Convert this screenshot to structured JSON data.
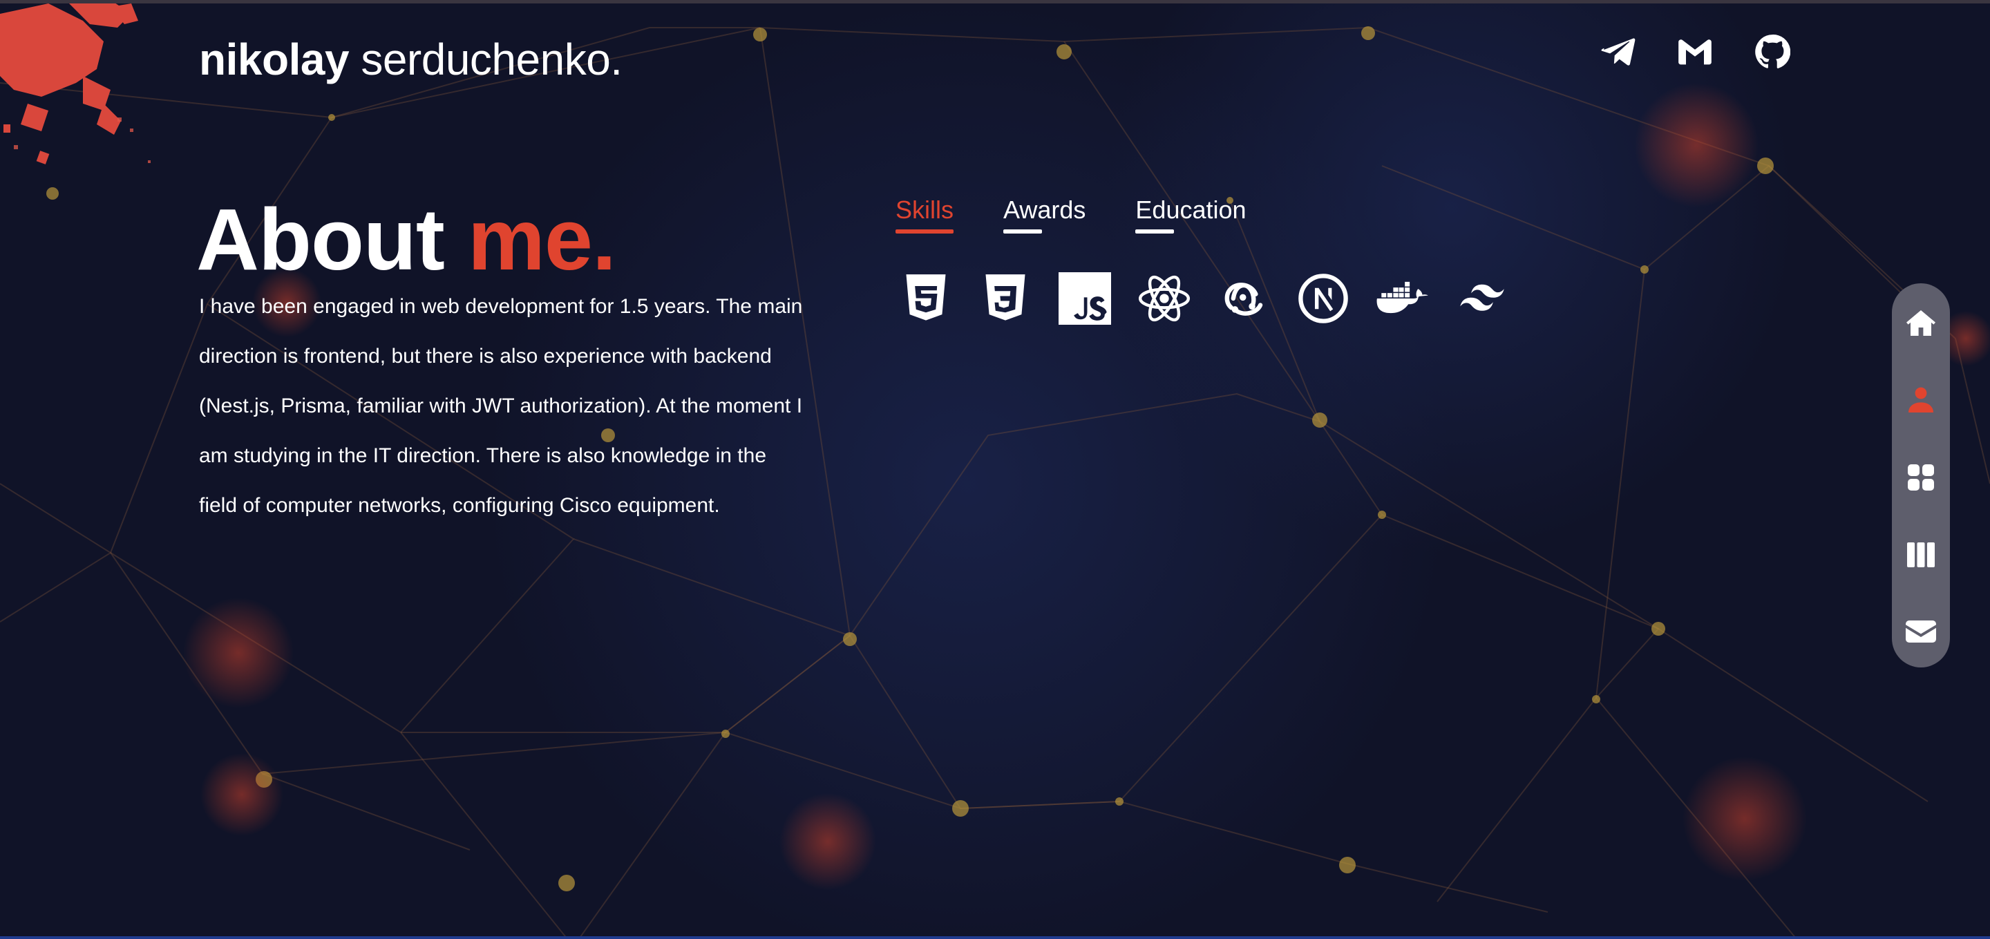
{
  "brand": {
    "first": "nikolay",
    "last": "serduchenko."
  },
  "social": [
    {
      "icon": "telegram-icon"
    },
    {
      "icon": "gmail-icon"
    },
    {
      "icon": "github-icon"
    }
  ],
  "about": {
    "title_main": "About",
    "title_accent": "me.",
    "description": "I have been engaged in web development for 1.5 years. The main direction is frontend, but there is also experience with backend (Nest.js, Prisma, familiar with JWT authorization). At the moment I am studying in the IT direction. There is also knowledge in the field of computer networks, configuring Cisco equipment."
  },
  "tabs": [
    {
      "label": "Skills",
      "active": true
    },
    {
      "label": "Awards",
      "active": false
    },
    {
      "label": "Education",
      "active": false
    }
  ],
  "skills": [
    {
      "icon": "html5-icon"
    },
    {
      "icon": "css3-icon"
    },
    {
      "icon": "javascript-icon"
    },
    {
      "icon": "react-icon"
    },
    {
      "icon": "redux-icon"
    },
    {
      "icon": "nextjs-icon"
    },
    {
      "icon": "docker-icon"
    },
    {
      "icon": "tailwind-icon"
    }
  ],
  "sidenav": [
    {
      "icon": "home-icon",
      "active": false
    },
    {
      "icon": "user-icon",
      "active": true
    },
    {
      "icon": "grid-icon",
      "active": false
    },
    {
      "icon": "columns-icon",
      "active": false
    },
    {
      "icon": "mail-icon",
      "active": false
    }
  ],
  "colors": {
    "background": "#101328",
    "accent": "#e0442f",
    "text": "#ffffff",
    "sidenav": "#5e5e6c"
  }
}
